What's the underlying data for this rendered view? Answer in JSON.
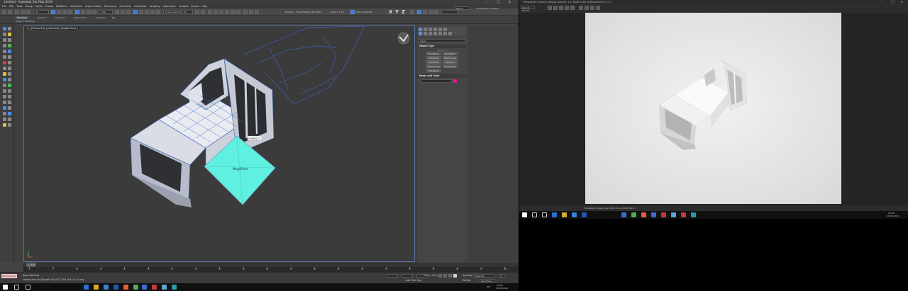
{
  "max_window": {
    "title": "Untitled - Autodesk 3ds Max 2019",
    "sign_in": "Sign In",
    "workspaces_label": "Workspaces:",
    "workspaces_value": "Default",
    "menu": [
      "File",
      "Edit",
      "Tools",
      "Group",
      "Views",
      "Create",
      "Modifiers",
      "Animation",
      "Graph Editors",
      "Rendering",
      "Civil View",
      "Customize",
      "Scripting",
      "Interactive",
      "Content",
      "Arnold",
      "Help"
    ],
    "toolbar": {
      "selection_filter": "All",
      "view_combo": "View",
      "named_selection": "Create Selection Se",
      "axes": [
        "X",
        "Y",
        "Z"
      ],
      "explorer_items": [
        "Explorer",
        "Flow Freeform",
        "Fill Mode",
        "Scale Tri: 4.4"
      ],
      "auto_key_set": "Auto Subdivide"
    },
    "ribbon": {
      "tabs": [
        "Modeling",
        "Freeform",
        "Selection",
        "Object Paint",
        "Populate"
      ],
      "active_tab": "Modeling",
      "sub_label": "Polygon Modeling"
    },
    "viewport": {
      "label": "[+] [Perspective ] [Standard ] [Edged Faces ]",
      "plane_label": "MegaPlane",
      "tooltip": "Ch4M2017"
    },
    "command_panel": {
      "category_combo": "Stairs",
      "object_type_heading": "Object Type",
      "autogrid": "AutoGrid",
      "buttons": [
        "MegaPlane",
        "MeshEditor",
        "MeshPolys",
        "MeshSplines",
        "MeshGeod",
        "MeshPinst",
        "MeshVolume",
        "MeshFrame",
        "MeshSurfs"
      ],
      "name_color_heading": "Name and Color"
    },
    "timeline": {
      "time_handle": "0 / 100",
      "ticks": [
        "0",
        "5",
        "10",
        "15",
        "20",
        "25",
        "30",
        "35",
        "40",
        "45",
        "50",
        "55",
        "60",
        "65",
        "70",
        "75",
        "80",
        "85",
        "90",
        "95",
        "100"
      ]
    },
    "status": {
      "maxscript": "MAXScript Mi",
      "none_selected": "None Selected",
      "prompt": "Vertex snap on ObjectEd for [40,774m, 8,44 m, 0,0m]",
      "grid": "Grid = 1,0m",
      "add_time_tag": "Add Time Tag",
      "auto_key": "Auto Key",
      "selected": "Selected",
      "set_key": "Set Key",
      "key_filters": "Key Filters...",
      "frame": "0"
    },
    "taskbar": {
      "time": "20:05",
      "date": "10.05.2021",
      "lang": "РУС"
    }
  },
  "frame_buffer": {
    "title": "Perspective, frame 0, Display Gamma: 2,2, RGBA Color 16 Bits/Channel (1:1)",
    "area_combo": "Area to Render",
    "status": "Rendering image (pass 1/10) done [00:00:04.1]",
    "taskbar": {
      "time": "20:05",
      "date": "10.05.2021"
    }
  },
  "colors": {
    "plane_fill": "#5ff0e0",
    "accent_blue": "#4a8ee8",
    "swatch_magenta": "#e2178e"
  }
}
